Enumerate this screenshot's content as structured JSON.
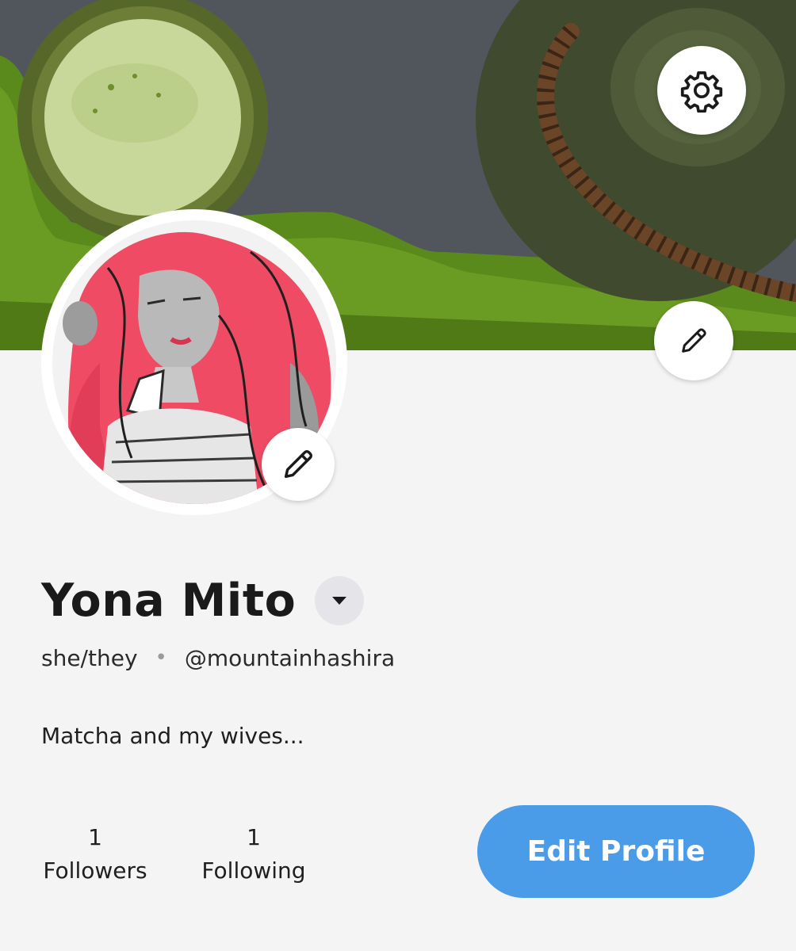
{
  "profile": {
    "display_name": "Yona Mito",
    "pronouns": "she/they",
    "separator": "•",
    "handle": "@mountainhashira",
    "bio": "Matcha and my wives..."
  },
  "stats": {
    "followers_count": "1",
    "followers_label": "Followers",
    "following_count": "1",
    "following_label": "Following"
  },
  "actions": {
    "edit_profile_label": "Edit Profile"
  },
  "icons": {
    "settings": "gear-icon",
    "edit_banner": "pencil-icon",
    "edit_avatar": "pencil-icon",
    "name_menu": "caret-down-icon"
  },
  "colors": {
    "accent": "#4a9be8",
    "page_background": "#f4f4f4",
    "dropdown_background": "#e5e5e9"
  }
}
